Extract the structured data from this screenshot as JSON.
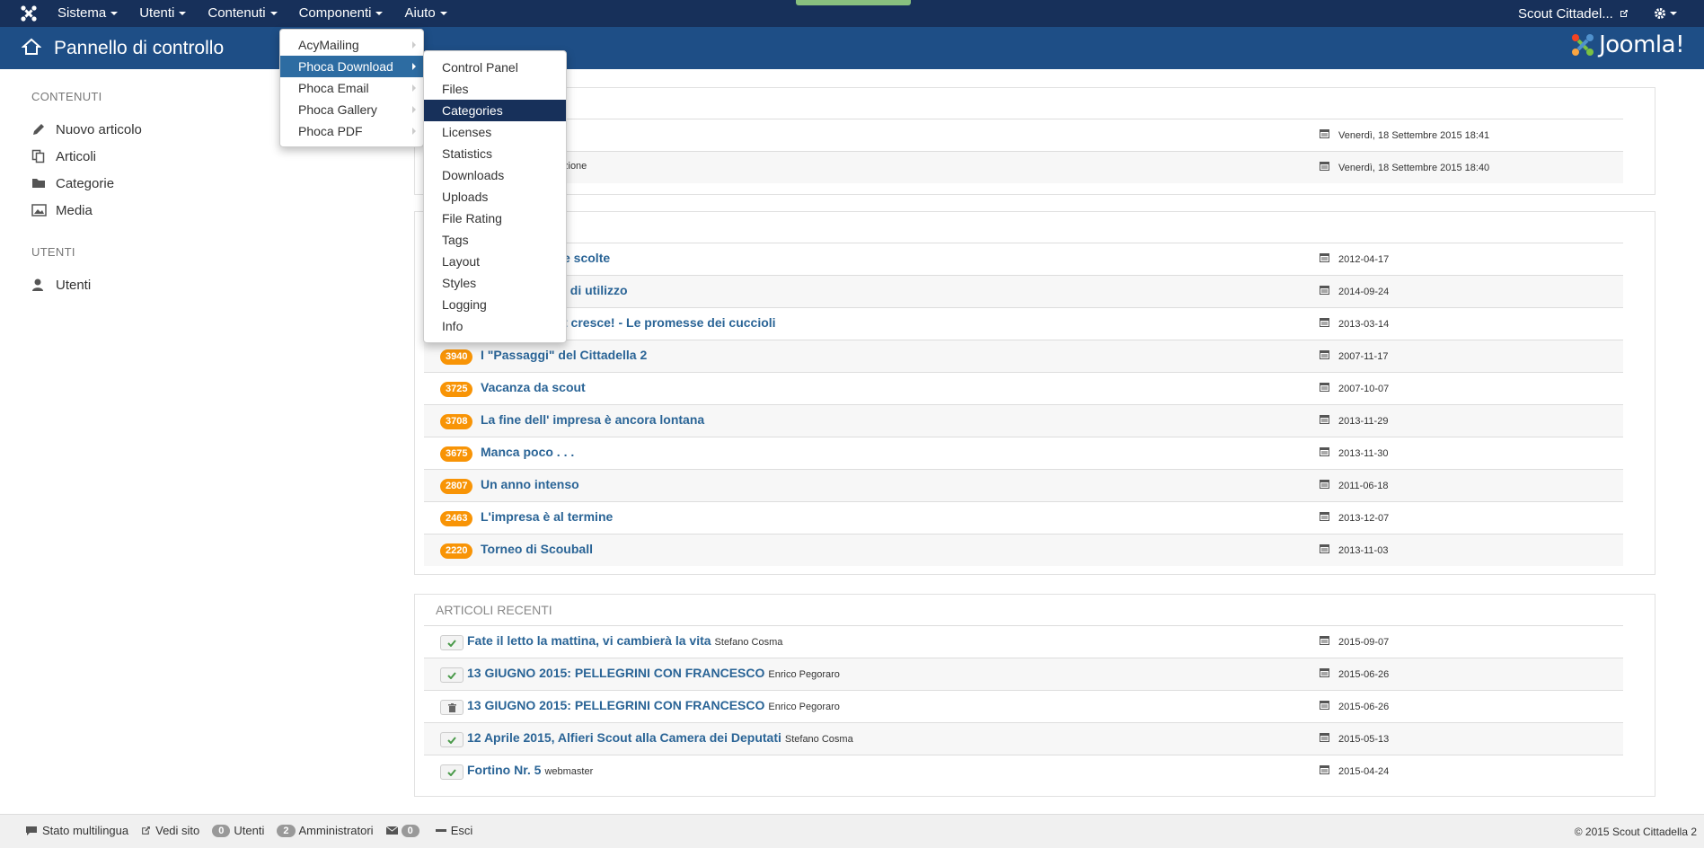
{
  "topnav": {
    "menu": [
      {
        "label": "Sistema"
      },
      {
        "label": "Utenti"
      },
      {
        "label": "Contenuti"
      },
      {
        "label": "Componenti"
      },
      {
        "label": "Aiuto"
      }
    ],
    "site_label": "Scout Cittadel..."
  },
  "header": {
    "title": "Pannello di controllo",
    "logo_text": "Joomla!"
  },
  "sidebar": {
    "section1": "CONTENUTI",
    "items1": [
      {
        "label": "Nuovo articolo",
        "icon": "pencil-icon"
      },
      {
        "label": "Articoli",
        "icon": "copy-icon"
      },
      {
        "label": "Categorie",
        "icon": "folder-icon"
      },
      {
        "label": "Media",
        "icon": "image-icon"
      }
    ],
    "section2": "UTENTI",
    "items2": [
      {
        "label": "Utenti",
        "icon": "user-icon"
      }
    ]
  },
  "components_menu": {
    "items": [
      {
        "label": "AcyMailing"
      },
      {
        "label": "Phoca Download"
      },
      {
        "label": "Phoca Email"
      },
      {
        "label": "Phoca Gallery"
      },
      {
        "label": "Phoca PDF"
      }
    ]
  },
  "phoca_download_menu": {
    "items": [
      {
        "label": "Control Panel"
      },
      {
        "label": "Files"
      },
      {
        "label": "Categories"
      },
      {
        "label": "Licenses"
      },
      {
        "label": "Statistics"
      },
      {
        "label": "Downloads"
      },
      {
        "label": "Uploads"
      },
      {
        "label": "File Rating"
      },
      {
        "label": "Tags"
      },
      {
        "label": "Layout"
      },
      {
        "label": "Styles"
      },
      {
        "label": "Logging"
      },
      {
        "label": "Info"
      }
    ]
  },
  "panel_logged": {
    "rows": [
      {
        "text": "",
        "date": "Venerdì, 18 Settembre 2015 18:41"
      },
      {
        "text": "zione",
        "date": "Venerdì, 18 Settembre 2015 18:40"
      }
    ]
  },
  "panel_popular": {
    "rows": [
      {
        "hits": "",
        "title": "e scolte",
        "date": "2012-04-17"
      },
      {
        "hits": "",
        "title": "i di utilizzo",
        "date": "2014-09-24"
      },
      {
        "hits": "",
        "title": "t cresce! - Le promesse dei cuccioli",
        "date": "2013-03-14"
      },
      {
        "hits": "3940",
        "title": "I \"Passaggi\" del Cittadella 2",
        "date": "2007-11-17"
      },
      {
        "hits": "3725",
        "title": "Vacanza da scout",
        "date": "2007-10-07"
      },
      {
        "hits": "3708",
        "title": "La fine dell' impresa è ancora lontana",
        "date": "2013-11-29"
      },
      {
        "hits": "3675",
        "title": "Manca poco . . .",
        "date": "2013-11-30"
      },
      {
        "hits": "2807",
        "title": "Un anno intenso",
        "date": "2011-06-18"
      },
      {
        "hits": "2463",
        "title": "L'impresa è al termine",
        "date": "2013-12-07"
      },
      {
        "hits": "2220",
        "title": "Torneo di Scouball",
        "date": "2013-11-03"
      }
    ]
  },
  "panel_recent": {
    "title": "ARTICOLI RECENTI",
    "rows": [
      {
        "status": "published",
        "title": "Fate il letto la mattina, vi cambierà la vita",
        "author": "Stefano Cosma",
        "date": "2015-09-07"
      },
      {
        "status": "published",
        "title": "13 GIUGNO 2015: PELLEGRINI CON FRANCESCO",
        "author": "Enrico Pegoraro",
        "date": "2015-06-26"
      },
      {
        "status": "trashed",
        "title": "13 GIUGNO 2015: PELLEGRINI CON FRANCESCO",
        "author": "Enrico Pegoraro",
        "date": "2015-06-26"
      },
      {
        "status": "published",
        "title": "12 Aprile 2015, Alfieri Scout alla Camera dei Deputati",
        "author": "Stefano Cosma",
        "date": "2015-05-13"
      },
      {
        "status": "published",
        "title": "Fortino Nr. 5",
        "author": "webmaster",
        "date": "2015-04-24"
      }
    ]
  },
  "footer": {
    "multilang": "Stato multilingua",
    "view_site": "Vedi sito",
    "users_count": "0",
    "users_label": "Utenti",
    "admins_count": "2",
    "admins_label": "Amministratori",
    "messages_count": "0",
    "logout": "Esci",
    "copyright": "© 2015 Scout Cittadella 2"
  },
  "colors": {
    "topnav_bg": "#17305a",
    "header_bg": "#1e4e86",
    "badge": "#f89406",
    "link": "#2a6496"
  }
}
